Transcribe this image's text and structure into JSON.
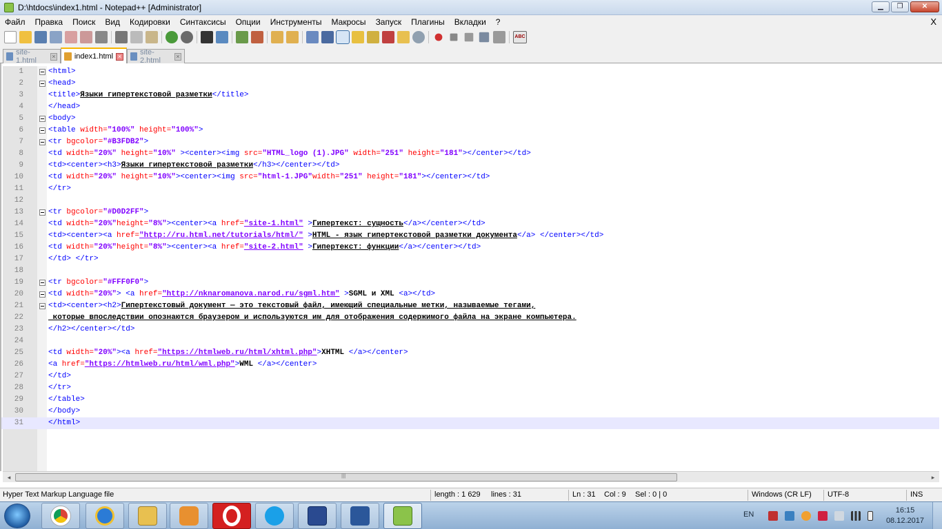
{
  "window": {
    "title": "D:\\htdocs\\index1.html - Notepad++ [Administrator]",
    "min_label": "▁",
    "max_label": "❐",
    "close_label": "✕"
  },
  "menu": {
    "items": [
      "Файл",
      "Правка",
      "Поиск",
      "Вид",
      "Кодировки",
      "Синтаксисы",
      "Опции",
      "Инструменты",
      "Макросы",
      "Запуск",
      "Плагины",
      "Вкладки",
      "?"
    ],
    "close_label": "X"
  },
  "toolbar": {
    "spellcheck_label": "ABC"
  },
  "tabs": [
    {
      "label": "site-1.html",
      "active": false
    },
    {
      "label": "index1.html",
      "active": true
    },
    {
      "label": "site-2.html",
      "active": false
    }
  ],
  "editor": {
    "current_line": 31,
    "lines": [
      "1",
      "2",
      "3",
      "4",
      "5",
      "6",
      "7",
      "8",
      "9",
      "10",
      "11",
      "12",
      "13",
      "14",
      "15",
      "16",
      "17",
      "18",
      "19",
      "20",
      "21",
      "22",
      "23",
      "24",
      "25",
      "26",
      "27",
      "28",
      "29",
      "30",
      "31"
    ],
    "code": {
      "l1": "<html>",
      "l2": "<head>",
      "l3_open": "<title>",
      "l3_text": "Языки гипертекстовой разметки",
      "l3_close": "</title>",
      "l4": "</head>",
      "l5": "<body>",
      "l6_tag": "<table",
      "l6_a1": " width=",
      "l6_v1": "\"100%\"",
      "l6_a2": " height=",
      "l6_v2": "\"100%\"",
      "l6_end": ">",
      "l7_tag": "<tr",
      "l7_a1": " bgcolor=",
      "l7_v1": "\"#B3FDB2\"",
      "l7_end": ">",
      "l8_tag": "<td",
      "l8_a1": " width=",
      "l8_v1": "\"20%\"",
      "l8_a2": " height=",
      "l8_v2": "\"10%\"",
      "l8_t2": " ><center><img",
      "l8_a3": " src=",
      "l8_v3": "\"HTML_logo (1).JPG\"",
      "l8_a4": " width=",
      "l8_v4": "\"251\"",
      "l8_a5": " height=",
      "l8_v5": "\"181\"",
      "l8_end": "></center></td>",
      "l9_open": "<td><center><h3>",
      "l9_text": "Языки гипертекстовой разметки",
      "l9_close": "</h3></center></td>",
      "l10_tag": "<td",
      "l10_a1": " width=",
      "l10_v1": "\"20%\"",
      "l10_a2": " height=",
      "l10_v2": "\"10%\"",
      "l10_t2": "><center><img",
      "l10_a3": " src=",
      "l10_v3": "\"html-1.JPG\"",
      "l10_a4": "width=",
      "l10_v4": "\"251\"",
      "l10_a5": " height=",
      "l10_v5": "\"181\"",
      "l10_end": "></center></td>",
      "l11": "</tr>",
      "l13_tag": "<tr",
      "l13_a1": " bgcolor=",
      "l13_v1": "\"#D0D2FF\"",
      "l13_end": ">",
      "l14_tag": "<td",
      "l14_a1": " width=",
      "l14_v1": "\"20%\"",
      "l14_a2": "height=",
      "l14_v2": "\"8%\"",
      "l14_t2": "><center><a",
      "l14_a3": " href=",
      "l14_v3": "\"site-1.html\"",
      "l14_t3": " >",
      "l14_text": "Гипертекст: сущность",
      "l14_end": "</a></center></td>",
      "l15_open": "<td><center><a",
      "l15_a1": " href=",
      "l15_v1": "\"http://ru.html.net/tutorials/html/\"",
      "l15_t2": " >",
      "l15_text": "HTML - язык гипертекстовой разметки документа",
      "l15_end": "</a> </center></td>",
      "l16_tag": "<td",
      "l16_a1": " width=",
      "l16_v1": "\"20%\"",
      "l16_a2": "height=",
      "l16_v2": "\"8%\"",
      "l16_t2": "><center><a",
      "l16_a3": " href=",
      "l16_v3": "\"site-2.html\"",
      "l16_t3": " >",
      "l16_text": "Гипертекст: функции",
      "l16_end": "</a></center></td>",
      "l17": "</td> </tr>",
      "l19_tag": "<tr",
      "l19_a1": " bgcolor=",
      "l19_v1": "\"#FFF0F0\"",
      "l19_end": ">",
      "l20_tag": "<td",
      "l20_a1": " width=",
      "l20_v1": "\"20%\"",
      "l20_t2": "> <a",
      "l20_a2": " href=",
      "l20_v2": "\"http://nknaromanova.narod.ru/sgml.htm\"",
      "l20_t3": " >",
      "l20_text": "SGML и XML ",
      "l20_end": "<a></td>",
      "l21_open": "<td><center><h2>",
      "l21_text": "Гипертекстовый документ — это текстовый файл, имеющий специальные метки, называемые тегами,",
      "l22_text": " которые впоследствии опознаются браузером и используются им для отображения содержимого файла на экране компьютера.",
      "l23": "</h2></center></td>",
      "l25_tag": "<td",
      "l25_a1": " width=",
      "l25_v1": "\"20%\"",
      "l25_t2": "><a",
      "l25_a2": " href=",
      "l25_v2": "\"https://htmlweb.ru/html/xhtml.php\"",
      "l25_t3": ">",
      "l25_text": "XHTML ",
      "l25_end": "</a></center>",
      "l26_tag": "<a",
      "l26_a1": " href=",
      "l26_v1": "\"https://htmlweb.ru/html/wml.php\"",
      "l26_t2": ">",
      "l26_text": "WML ",
      "l26_end": "</a></center>",
      "l27": "</td>",
      "l28": "</tr>",
      "l29": "</table>",
      "l30": "</body>",
      "l31": "</html>"
    }
  },
  "scrollbar": {
    "left_arrow": "◂",
    "right_arrow": "▸",
    "grip": "|||"
  },
  "status": {
    "file_type": "Hyper Text Markup Language file",
    "length": "length : 1 629",
    "lines": "lines : 31",
    "ln": "Ln : 31",
    "col": "Col : 9",
    "sel": "Sel : 0 | 0",
    "eol": "Windows (CR LF)",
    "encoding": "UTF-8",
    "mode": "INS"
  },
  "taskbar": {
    "lang": "EN",
    "time": "16:15",
    "date": "08.12.2017",
    "apps": [
      "chrome-icon",
      "ie-icon",
      "explorer-icon",
      "media-player-icon",
      "opera-icon",
      "skype-icon",
      "floppy-icon",
      "word-icon",
      "notepadpp-icon"
    ]
  },
  "colors": {
    "tag": "#0000ff",
    "attr": "#ff0000",
    "value": "#8000ff",
    "current_line": "#e8e8ff"
  }
}
